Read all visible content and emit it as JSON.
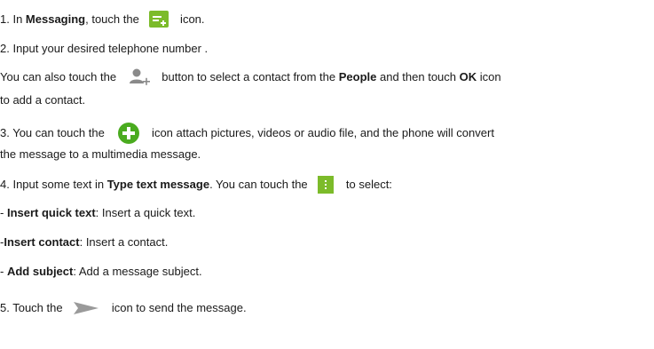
{
  "steps": {
    "s1": {
      "num": "1. In ",
      "bold1": "Messaging",
      "mid": ", touch the ",
      "end": " icon.",
      "icon": "new-message-icon"
    },
    "s2": {
      "text": "2. Input your desired telephone number ."
    },
    "s2b": {
      "pre": "You can also touch the ",
      "mid": " button to select a contact from the ",
      "bold1": "People",
      "mid2": " and then touch ",
      "bold2": "OK",
      "end": " icon",
      "icon": "add-contact-icon"
    },
    "s2c": {
      "text": "to add a contact."
    },
    "s3": {
      "pre": "3. You can touch the ",
      "end": " icon attach pictures, videos or audio file, and the phone will convert",
      "icon": "attach-plus-icon"
    },
    "s3b": {
      "text": "the message to a multimedia message."
    },
    "s4": {
      "pre": "4. Input some text in ",
      "bold1": "Type text message",
      "mid": ". You can touch the ",
      "end": " to select:",
      "icon": "menu-icon"
    },
    "o1": {
      "pre": "- ",
      "bold": "Insert quick text",
      "end": ": Insert a quick text."
    },
    "o2": {
      "pre": "-",
      "bold": "Insert contact",
      "end": ": Insert a contact."
    },
    "o3": {
      "pre": "- ",
      "bold": "Add subject",
      "end": ": Add a message subject."
    },
    "s5": {
      "pre": "5. Touch the ",
      "end": " icon to send the message.",
      "icon": "send-icon"
    }
  },
  "colors": {
    "icon_green": "#7cbb2a",
    "attach_green": "#4aab1f",
    "contact_gray": "#8a8a8a",
    "send_gray": "#9a9a9a"
  }
}
